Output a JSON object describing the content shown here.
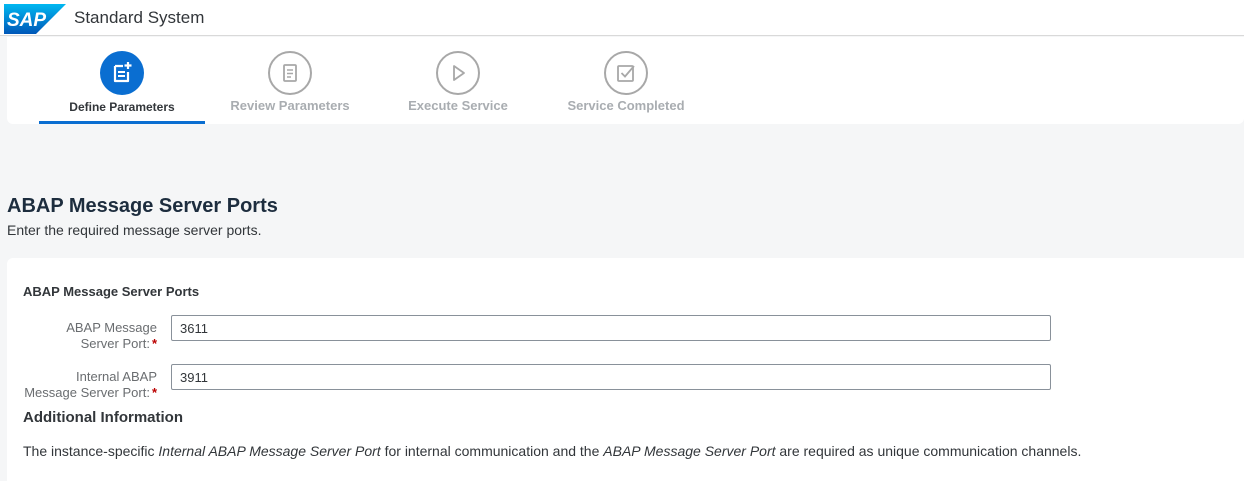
{
  "shell": {
    "logo_text": "SAP",
    "title": "Standard System"
  },
  "wizard": {
    "steps": [
      {
        "label": "Define Parameters",
        "icon": "add-document-icon",
        "state": "active"
      },
      {
        "label": "Review Parameters",
        "icon": "checklist-icon",
        "state": "inactive"
      },
      {
        "label": "Execute Service",
        "icon": "play-icon",
        "state": "inactive"
      },
      {
        "label": "Service Completed",
        "icon": "checkbox-icon",
        "state": "inactive"
      }
    ]
  },
  "page": {
    "title": "ABAP Message Server Ports",
    "subtitle": "Enter the required message server ports."
  },
  "form": {
    "section_title": "ABAP Message Server Ports",
    "fields": [
      {
        "label_line1": "ABAP Message",
        "label_line2": "Server Port:",
        "value": "3611",
        "required": "*"
      },
      {
        "label_line1": "Internal ABAP",
        "label_line2": "Message Server Port:",
        "value": "3911",
        "required": "*"
      }
    ]
  },
  "additional_info": {
    "title": "Additional Information",
    "text_1": "The instance-specific ",
    "text_2": "Internal ABAP Message Server Port",
    "text_3": " for internal communication and the ",
    "text_4": "ABAP Message Server Port",
    "text_5": " are required as unique communication channels."
  },
  "colors": {
    "accent": "#0a6ed1",
    "required": "#bb0000",
    "inactive_step": "#a9adb1"
  }
}
